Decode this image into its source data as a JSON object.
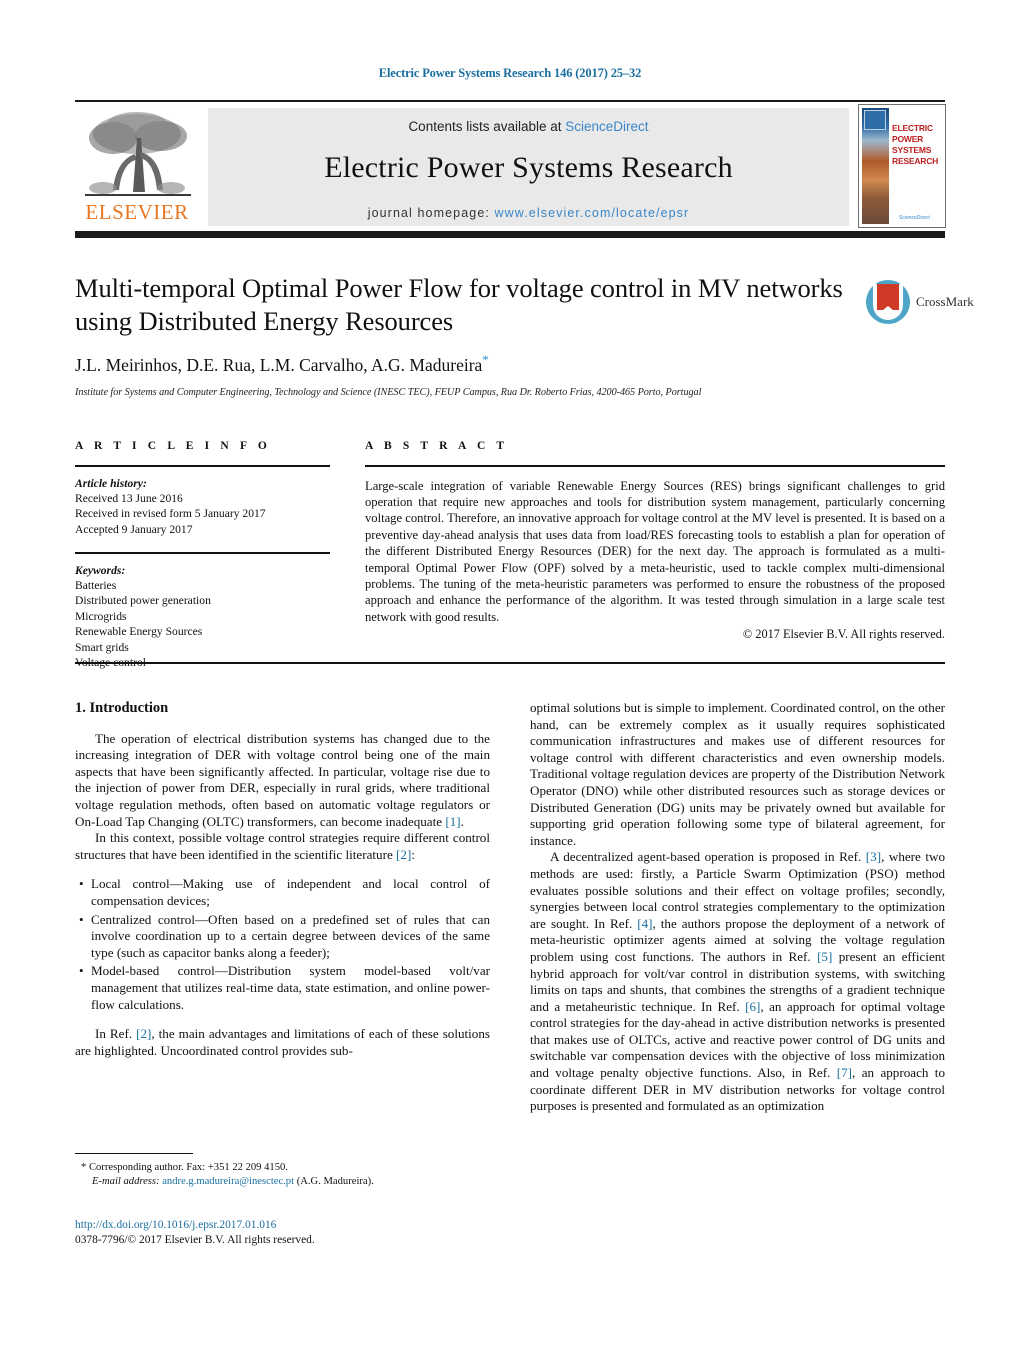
{
  "running_head": "Electric Power Systems Research 146 (2017) 25–32",
  "masthead": {
    "contents_prefix": "Contents lists available at ",
    "sciencedirect": "ScienceDirect",
    "journal_title": "Electric Power Systems Research",
    "homepage_prefix": "journal homepage: ",
    "homepage_url": "www.elsevier.com/locate/epsr",
    "publisher_logo_text": "ELSEVIER",
    "cover_title": "ELECTRIC POWER SYSTEMS RESEARCH",
    "cover_footer": "ScienceDirect",
    "colors": {
      "link": "#3a86c8",
      "elsevier_orange": "#e87722",
      "panel_bg": "#e9e9e9"
    }
  },
  "title_block": {
    "title": "Multi-temporal Optimal Power Flow for voltage control in MV networks using Distributed Energy Resources",
    "authors": "J.L. Meirinhos, D.E. Rua, L.M. Carvalho, A.G. Madureira",
    "corresponding_marker": "*",
    "affiliation": "Institute for Systems and Computer Engineering, Technology and Science (INESC TEC), FEUP Campus, Rua Dr. Roberto Frias, 4200-465 Porto, Portugal",
    "crossmark_label": "CrossMark"
  },
  "article_info": {
    "heading": "A R T I C L E     I N F O",
    "history_label": "Article history:",
    "history": [
      "Received 13 June 2016",
      "Received in revised form 5 January 2017",
      "Accepted 9 January 2017"
    ],
    "keywords_label": "Keywords:",
    "keywords": [
      "Batteries",
      "Distributed power generation",
      "Microgrids",
      "Renewable Energy Sources",
      "Smart grids",
      "Voltage control"
    ]
  },
  "abstract": {
    "heading": "A B S T R A C T",
    "text": "Large-scale integration of variable Renewable Energy Sources (RES) brings significant challenges to grid operation that require new approaches and tools for distribution system management, particularly concerning voltage control. Therefore, an innovative approach for voltage control at the MV level is presented. It is based on a preventive day-ahead analysis that uses data from load/RES forecasting tools to establish a plan for operation of the different Distributed Energy Resources (DER) for the next day. The approach is formulated as a multi-temporal Optimal Power Flow (OPF) solved by a meta-heuristic, used to tackle complex multi-dimensional problems. The tuning of the meta-heuristic parameters was performed to ensure the robustness of the proposed approach and enhance the performance of the algorithm. It was tested through simulation in a large scale test network with good results.",
    "copyright": "© 2017 Elsevier B.V. All rights reserved."
  },
  "body": {
    "section_heading": "1.  Introduction",
    "left_para_1": "The operation of electrical distribution systems has changed due to the increasing integration of DER with voltage control being one of the main aspects that have been significantly affected. In particular, voltage rise due to the injection of power from DER, especially in rural grids, where traditional voltage regulation methods, often based on automatic voltage regulators or On-Load Tap Changing (OLTC) transformers, can become inadequate ",
    "left_para_1_ref": "[1]",
    "left_para_1_end": ".",
    "left_para_2": "In this context, possible voltage control strategies require different control structures that have been identified in the scientific literature ",
    "left_para_2_ref": "[2]",
    "left_para_2_end": ":",
    "bullets": [
      "Local control—Making use of independent and local control of compensation devices;",
      "Centralized control—Often based on a predefined set of rules that can involve coordination up to a certain degree between devices of the same type (such as capacitor banks along a feeder);",
      "Model-based control—Distribution system model-based volt/var management that utilizes real-time data, state estimation, and online power-flow calculations."
    ],
    "left_para_3_a": "In Ref. ",
    "left_para_3_ref": "[2]",
    "left_para_3_b": ", the main advantages and limitations of each of these solutions are highlighted. Uncoordinated control provides sub-",
    "right_para_1": "optimal solutions but is simple to implement. Coordinated control, on the other hand, can be extremely complex as it usually requires sophisticated communication infrastructures and makes use of different resources for voltage control with different characteristics and even ownership models. Traditional voltage regulation devices are property of the Distribution Network Operator (DNO) while other distributed resources such as storage devices or Distributed Generation (DG) units may be privately owned but available for supporting grid operation following some type of bilateral agreement, for instance.",
    "right_para_2_a": "A decentralized agent-based operation is proposed in Ref. ",
    "right_para_2_ref1": "[3]",
    "right_para_2_b": ", where two methods are used: firstly, a Particle Swarm Optimization (PSO) method evaluates possible solutions and their effect on voltage profiles; secondly, synergies between local control strategies complementary to the optimization are sought. In Ref. ",
    "right_para_2_ref2": "[4]",
    "right_para_2_c": ", the authors propose the deployment of a network of meta-heuristic optimizer agents aimed at solving the voltage regulation problem using cost functions. The authors in Ref. ",
    "right_para_2_ref3": "[5]",
    "right_para_2_d": " present an efficient hybrid approach for volt/var control in distribution systems, with switching limits on taps and shunts, that combines the strengths of a gradient technique and a metaheuristic technique. In Ref. ",
    "right_para_2_ref4": "[6]",
    "right_para_2_e": ", an approach for optimal voltage control strategies for the day-ahead in active distribution networks is presented that makes use of OLTCs, active and reactive power control of DG units and switchable var compensation devices with the objective of loss minimization and voltage penalty objective functions. Also, in Ref. ",
    "right_para_2_ref5": "[7]",
    "right_para_2_f": ", an approach to coordinate different DER in MV distribution networks for voltage control purposes is presented and formulated as an optimization"
  },
  "footnote": {
    "marker": "*",
    "corresponding": " Corresponding author. Fax: +351 22 209 4150.",
    "email_label": "E-mail address:",
    "email": "andre.g.madureira@inesctec.pt",
    "email_owner": "(A.G. Madureira)."
  },
  "doi_block": {
    "doi": "http://dx.doi.org/10.1016/j.epsr.2017.01.016",
    "issn_line": "0378-7796/© 2017 Elsevier B.V. All rights reserved."
  }
}
